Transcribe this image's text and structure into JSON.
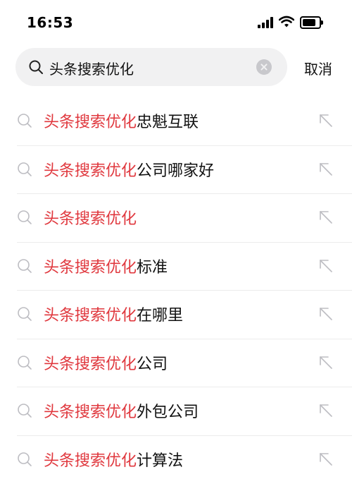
{
  "status_bar": {
    "time": "16:53",
    "battery_level": 0.8
  },
  "search": {
    "query": "头条搜索优化",
    "cancel_label": "取消"
  },
  "suggestions": [
    {
      "highlight": "头条搜索优化",
      "suffix": "忠魁互联"
    },
    {
      "highlight": "头条搜索优化",
      "suffix": "公司哪家好"
    },
    {
      "highlight": "头条搜索优化",
      "suffix": ""
    },
    {
      "highlight": "头条搜索优化",
      "suffix": "标准"
    },
    {
      "highlight": "头条搜索优化",
      "suffix": "在哪里"
    },
    {
      "highlight": "头条搜索优化",
      "suffix": "公司"
    },
    {
      "highlight": "头条搜索优化",
      "suffix": "外包公司"
    },
    {
      "highlight": "头条搜索优化",
      "suffix": "计算法"
    }
  ],
  "colors": {
    "highlight": "#e0383e",
    "search_bg": "#f1f1f2",
    "icon_gray": "#bdbdc2"
  },
  "icons": {
    "suggestion_leading": "search-icon",
    "suggestion_trailing": "fill-query-arrow-icon"
  }
}
